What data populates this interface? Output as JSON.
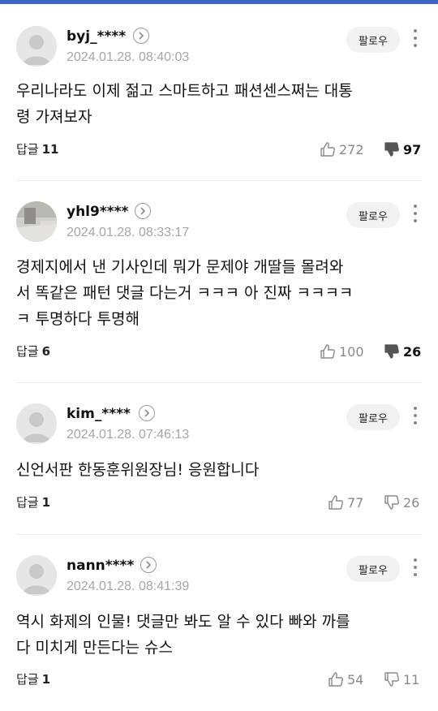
{
  "ui": {
    "follow_label": "팔로우",
    "reply_label": "답글",
    "accent_color": "#3e63c7"
  },
  "comments": [
    {
      "nickname": "byj_****",
      "datetime": "2024.01.28. 08:40:03",
      "text_lines": [
        "우리나라도 이제 젊고 스마트하고 패션센스쩌는 대통",
        "령 가져보자"
      ],
      "reply_count": "11",
      "likes": "272",
      "dislikes": "97",
      "avatar": "default-avatar-icon"
    },
    {
      "nickname": "yhl9****",
      "datetime": "2024.01.28. 08:33:17",
      "text_lines": [
        "경제지에서 낸 기사인데 뭐가 문제야 개딸들 몰려와",
        "서 똑같은 패턴 댓글 다는거 ㅋㅋㅋ 아 진짜 ㅋㅋㅋㅋ",
        "ㅋ 투명하다 투명해"
      ],
      "reply_count": "6",
      "likes": "100",
      "dislikes": "26",
      "avatar": "photo-avatar"
    },
    {
      "nickname": "kim_****",
      "datetime": "2024.01.28. 07:46:13",
      "text_lines": [
        "신언서판 한동훈위원장님! 응원합니다"
      ],
      "reply_count": "1",
      "likes": "77",
      "dislikes": "26",
      "avatar": "default-avatar-icon"
    },
    {
      "nickname": "nann****",
      "datetime": "2024.01.28. 08:41:39",
      "text_lines": [
        "역시 화제의 인물! 댓글만 봐도 알 수 있다 빠와 까를",
        "다 미치게 만든다는 슈스"
      ],
      "reply_count": "1",
      "likes": "54",
      "dislikes": "11",
      "avatar": "default-avatar-icon"
    }
  ]
}
